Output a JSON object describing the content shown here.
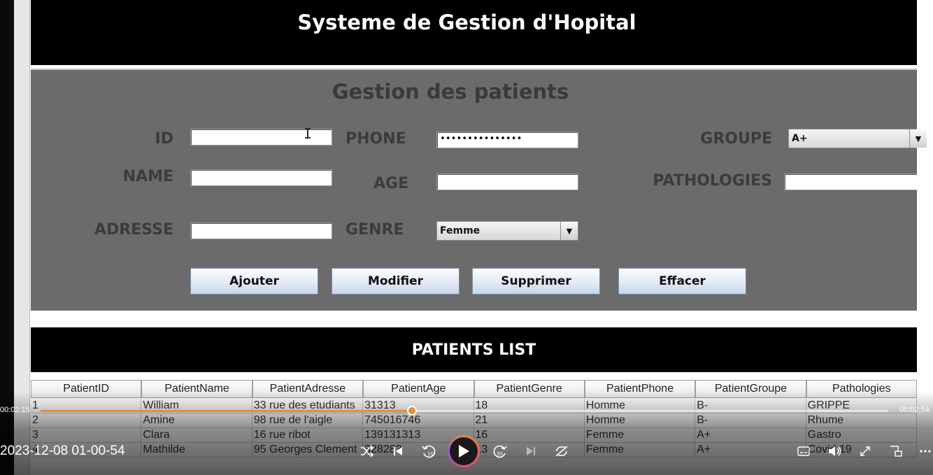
{
  "app": {
    "title": "Systeme de Gestion d'Hopital"
  },
  "form": {
    "title": "Gestion des patients",
    "labels": {
      "id": "ID",
      "name": "NAME",
      "adresse": "ADRESSE",
      "phone": "PHONE",
      "age": "AGE",
      "genre": "GENRE",
      "groupe": "GROUPE",
      "pathologies": "PATHOLOGIES"
    },
    "values": {
      "id": "",
      "name": "",
      "adresse": "",
      "phone": "•••••••••••••••",
      "age": "",
      "pathologies": ""
    },
    "genre_selected": "Femme",
    "groupe_selected": "A+",
    "buttons": {
      "add": "Ajouter",
      "modify": "Modifier",
      "delete": "Supprimer",
      "clear": "Effacer"
    }
  },
  "patients_list": {
    "title": "PATIENTS LIST",
    "columns": [
      "PatientID",
      "PatientName",
      "PatientAdresse",
      "PatientAge",
      "PatientGenre",
      "PatientPhone",
      "PatientGroupe",
      "Pathologies"
    ],
    "rows": [
      [
        "1",
        "William",
        "33 rue des etudiants",
        "31313",
        "18",
        "Homme",
        "B-",
        "GRIPPE"
      ],
      [
        "2",
        "Amine",
        "98 rue de l'aigle",
        "745016746",
        "21",
        "Homme",
        "B-",
        "Rhume"
      ],
      [
        "3",
        "Clara",
        "16 rue ribot",
        "139131313",
        "16",
        "Femme",
        "A+",
        "Gastro"
      ],
      [
        "4",
        "Mathilde",
        "95 Georges Clement",
        "328283",
        "13",
        "Femme",
        "A+",
        "Covid 19"
      ]
    ]
  },
  "player": {
    "elapsed": "00:02:15",
    "total": "00:02:54",
    "progress_fraction": 0.438,
    "timestamp": "2023-12-08 01-00-54",
    "accent": "#e88b3a"
  }
}
